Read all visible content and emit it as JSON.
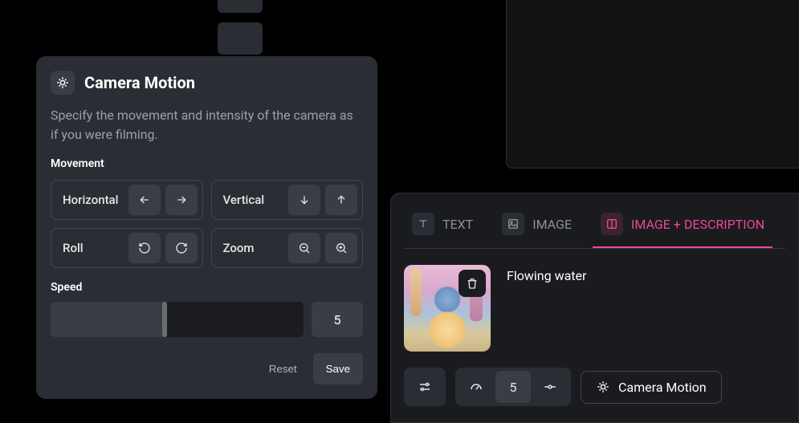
{
  "cameraMotion": {
    "title": "Camera Motion",
    "description": "Specify the movement and intensity of the camera as if you were filming.",
    "movementLabel": "Movement",
    "movements": {
      "horizontal": "Horizontal",
      "vertical": "Vertical",
      "roll": "Roll",
      "zoom": "Zoom"
    },
    "speedLabel": "Speed",
    "speedValue": "5",
    "speedPercent": 45,
    "resetLabel": "Reset",
    "saveLabel": "Save"
  },
  "tabs": {
    "text": "TEXT",
    "image": "IMAGE",
    "imageDesc": "IMAGE + DESCRIPTION"
  },
  "content": {
    "descriptionText": "Flowing water"
  },
  "controls": {
    "speedValue": "5",
    "cameraMotionLabel": "Camera Motion"
  }
}
